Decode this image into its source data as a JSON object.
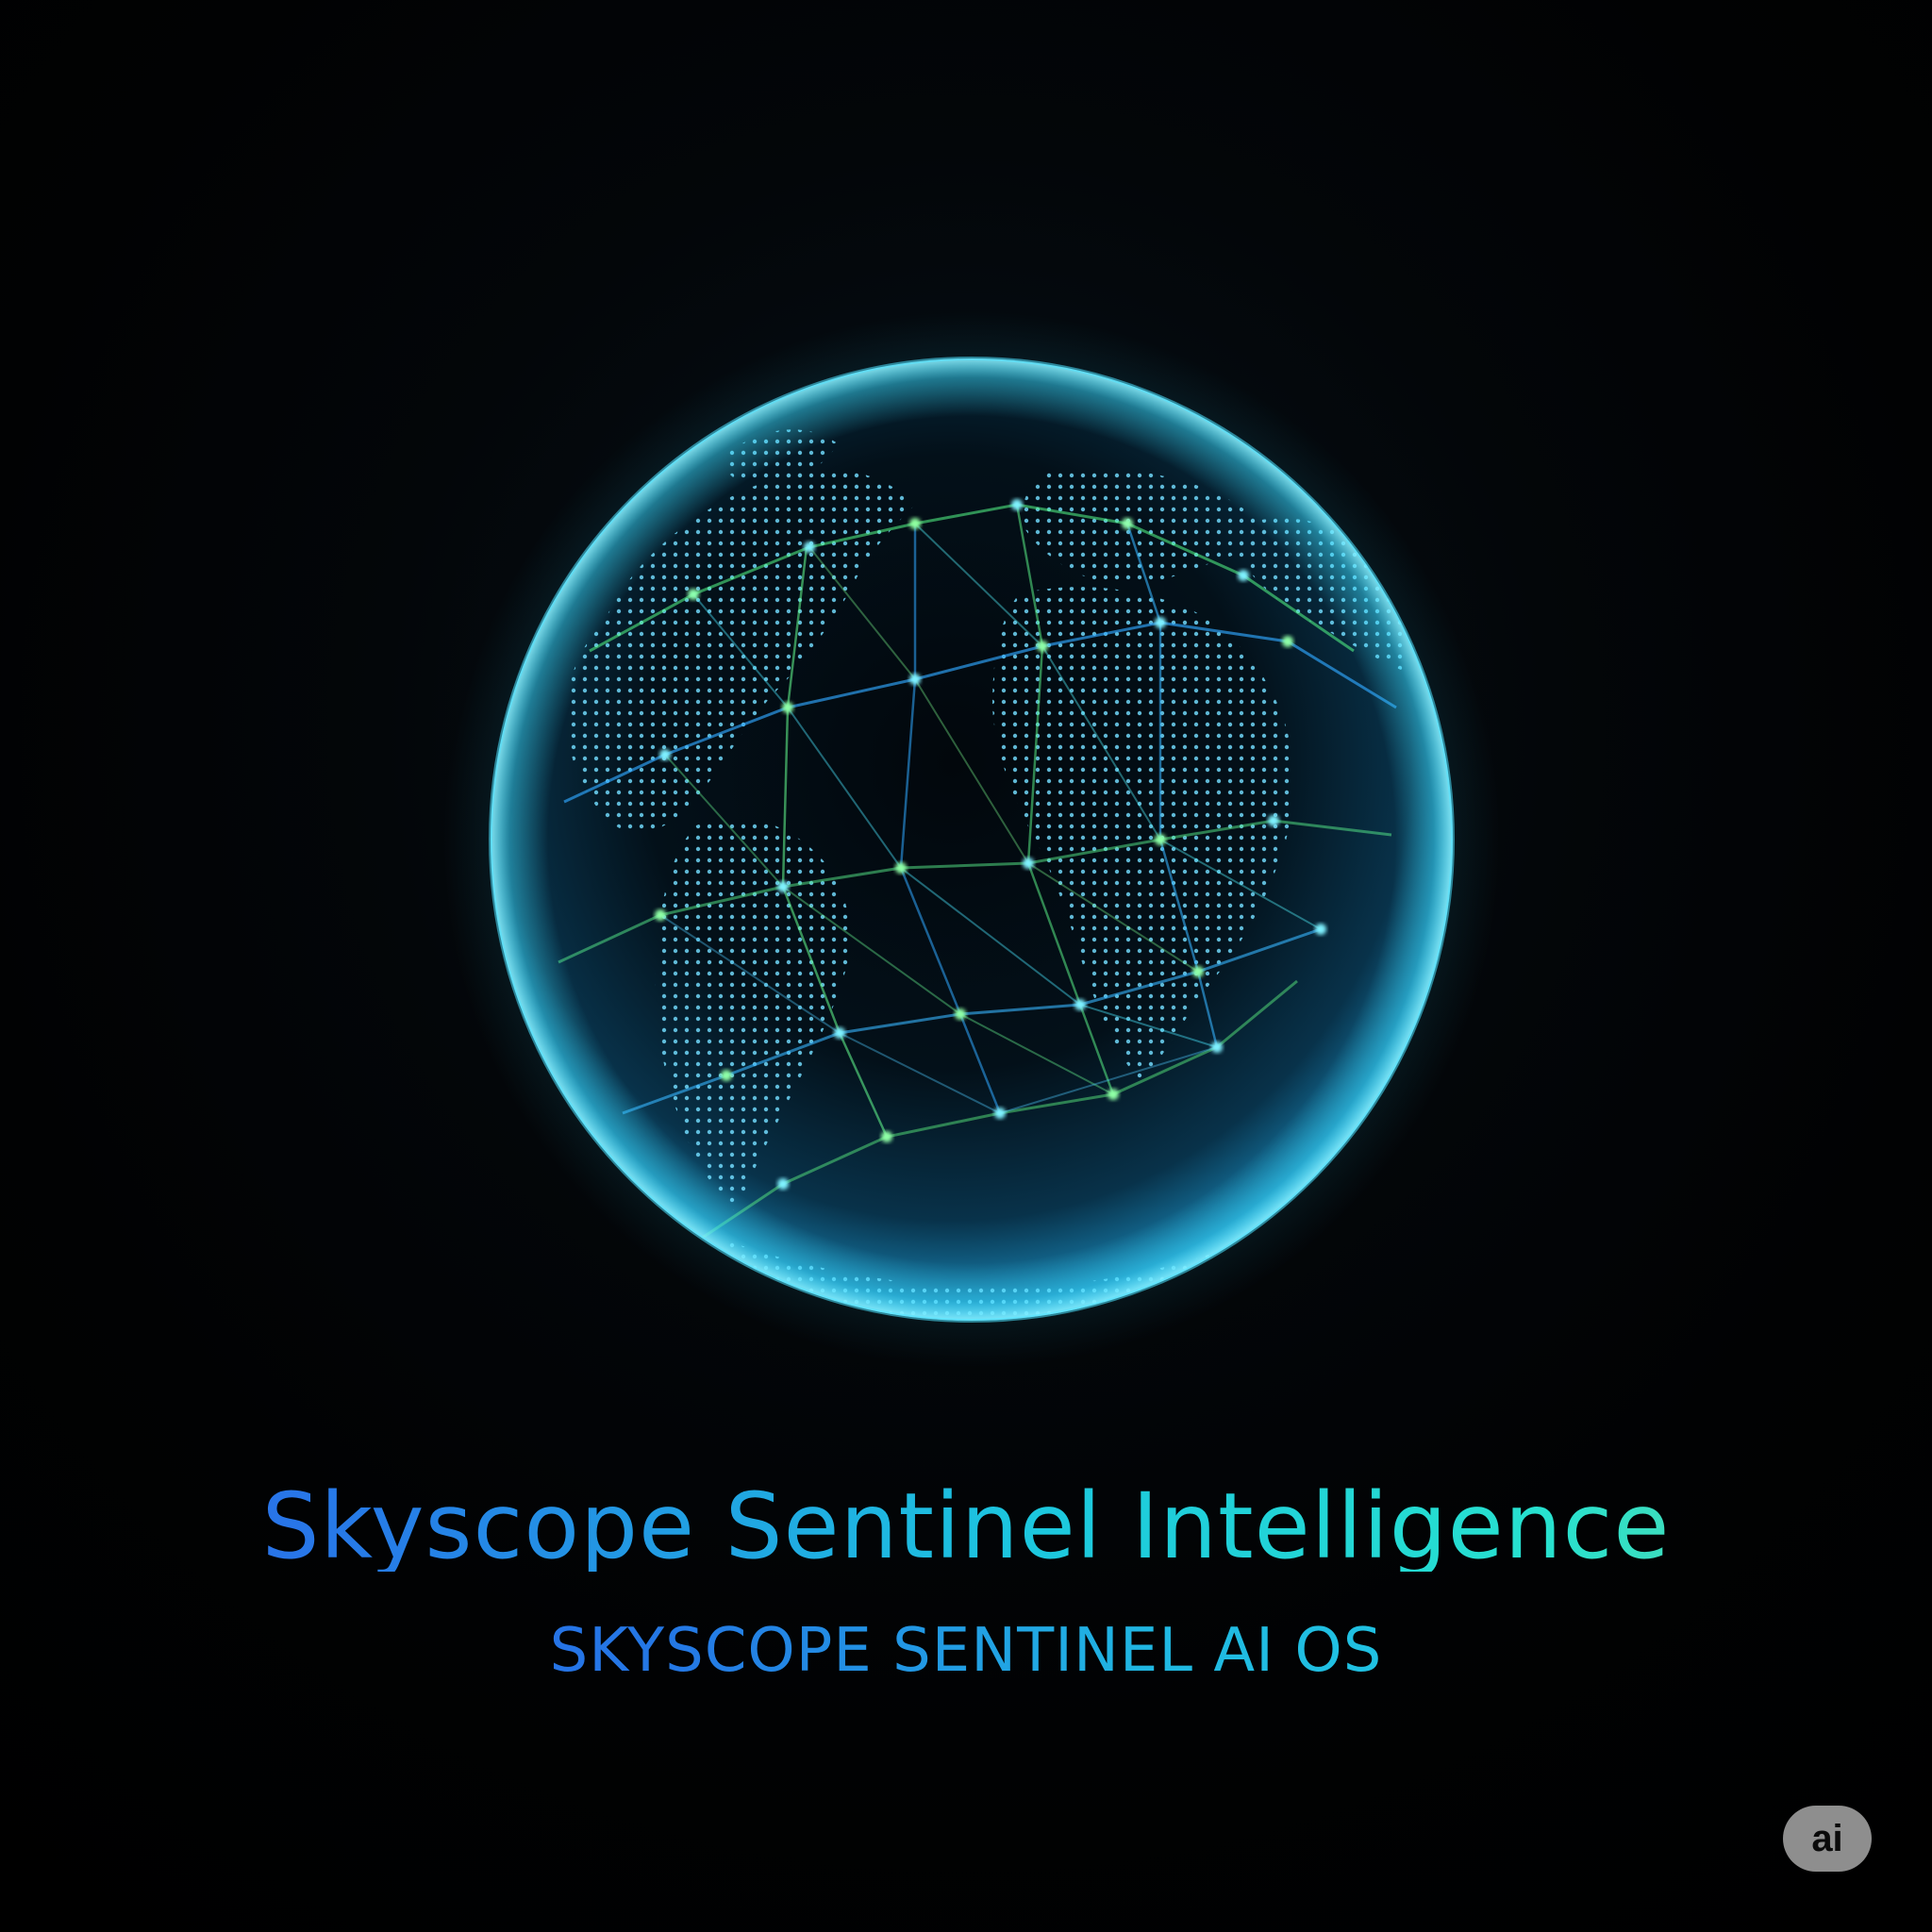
{
  "brand": {
    "title": "Skyscope Sentinel Intelligence",
    "subtitle": "SKYSCOPE SENTINEL AI OS"
  },
  "badge": {
    "label": "ai"
  },
  "graphic": {
    "name": "network-globe",
    "colors": {
      "glow": "#38d9ff",
      "land": "#5fd3ff",
      "network_green": "#55ff8a",
      "network_blue": "#35a8ff",
      "background": "#000000"
    }
  }
}
